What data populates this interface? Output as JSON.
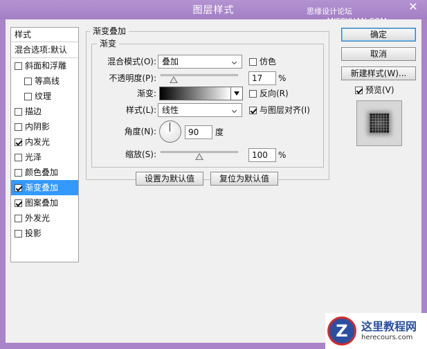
{
  "window": {
    "title": "图层样式",
    "watermark": "思缘设计论坛 www.MISSYUAN.COM",
    "close_glyph": "✕"
  },
  "styles_panel": {
    "header": "样式",
    "blend_options": "混合选项:默认",
    "items": [
      {
        "label": "斜面和浮雕",
        "checked": false
      },
      {
        "label": "等高线",
        "checked": false,
        "sub": true
      },
      {
        "label": "纹理",
        "checked": false,
        "sub": true
      },
      {
        "label": "描边",
        "checked": false
      },
      {
        "label": "内阴影",
        "checked": false
      },
      {
        "label": "内发光",
        "checked": true
      },
      {
        "label": "光泽",
        "checked": false
      },
      {
        "label": "颜色叠加",
        "checked": false
      },
      {
        "label": "渐变叠加",
        "checked": true,
        "active": true
      },
      {
        "label": "图案叠加",
        "checked": true
      },
      {
        "label": "外发光",
        "checked": false
      },
      {
        "label": "投影",
        "checked": false
      }
    ]
  },
  "gradient_overlay": {
    "group_title": "渐变叠加",
    "sub_title": "渐变",
    "blend_mode_label": "混合模式(O):",
    "blend_mode_value": "叠加",
    "dither_label": "仿色",
    "dither_checked": false,
    "opacity_label": "不透明度(P):",
    "opacity_value": "17",
    "opacity_fraction": 0.17,
    "percent_unit": "%",
    "gradient_label": "渐变:",
    "reverse_label": "反向(R)",
    "reverse_checked": false,
    "style_label": "样式(L):",
    "style_value": "线性",
    "align_label": "与图层对齐(I)",
    "align_checked": true,
    "angle_label": "角度(N):",
    "angle_value": "90",
    "degree_unit": "度",
    "scale_label": "缩放(S):",
    "scale_value": "100",
    "scale_fraction": 0.5,
    "make_default": "设置为默认值",
    "reset_default": "复位为默认值"
  },
  "right_buttons": {
    "ok": "确定",
    "cancel": "取消",
    "new_style": "新建样式(W)...",
    "preview_label": "预览(V)",
    "preview_checked": true
  },
  "logo": {
    "mark": "Z",
    "name": "这里教程网",
    "url": "herecours.com"
  }
}
